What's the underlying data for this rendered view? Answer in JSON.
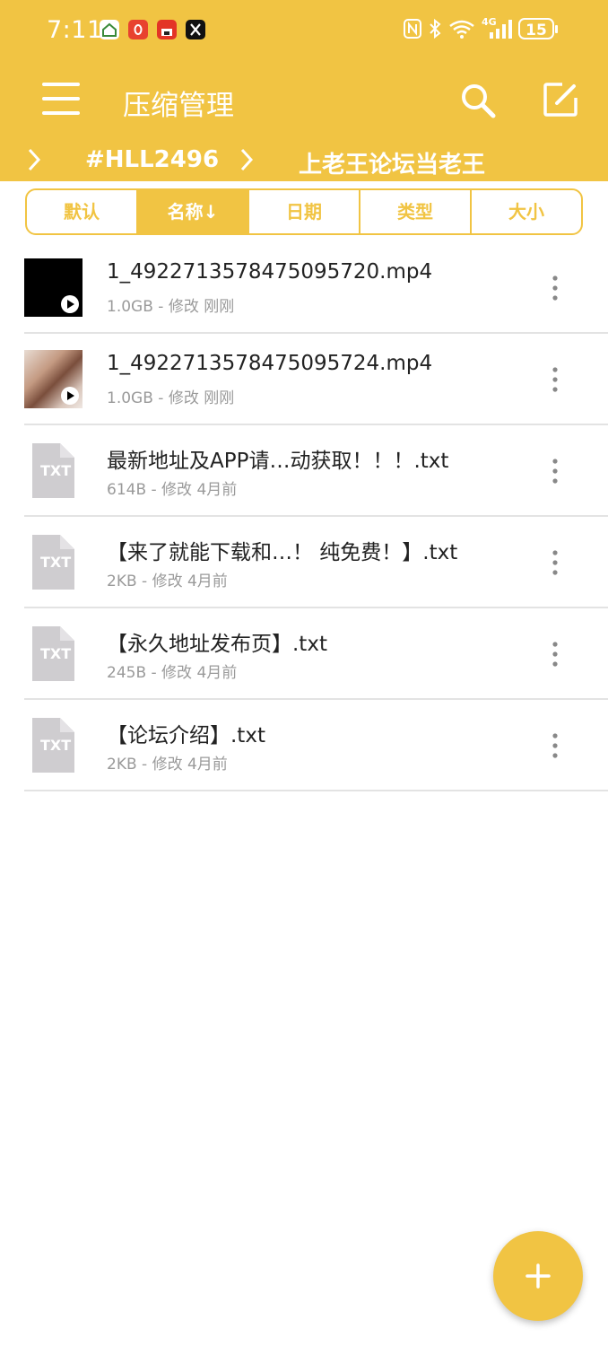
{
  "status_bar": {
    "time": "7:11",
    "battery": "15",
    "network": "4G"
  },
  "app_bar": {
    "title": "压缩管理"
  },
  "breadcrumb": {
    "items": [
      "#HLL2496",
      "上老王论坛当老王"
    ]
  },
  "sort_tabs": [
    {
      "label": "默认",
      "active": false
    },
    {
      "label": "名称↓",
      "active": true
    },
    {
      "label": "日期",
      "active": false
    },
    {
      "label": "类型",
      "active": false
    },
    {
      "label": "大小",
      "active": false
    }
  ],
  "files": [
    {
      "name": "1_4922713578475095720.mp4",
      "meta": "1.0GB - 修改 刚刚",
      "type": "video"
    },
    {
      "name": "1_4922713578475095724.mp4",
      "meta": "1.0GB - 修改 刚刚",
      "type": "video"
    },
    {
      "name": "最新地址及APP请…动获取！！！.txt",
      "meta": "614B - 修改 4月前",
      "type": "txt",
      "icon_label": "TXT"
    },
    {
      "name": "【来了就能下载和…！ 纯免费！】.txt",
      "meta": "2KB - 修改 4月前",
      "type": "txt",
      "icon_label": "TXT"
    },
    {
      "name": "【永久地址发布页】.txt",
      "meta": "245B - 修改 4月前",
      "type": "txt",
      "icon_label": "TXT"
    },
    {
      "name": "【论坛介绍】.txt",
      "meta": "2KB - 修改 4月前",
      "type": "txt",
      "icon_label": "TXT"
    }
  ],
  "colors": {
    "accent": "#f1c443",
    "divider": "#e3e3e3",
    "txt_icon": "#cfcdd0"
  },
  "icons": {
    "menu": "hamburger-icon",
    "search": "search-icon",
    "edit": "edit-icon",
    "fab": "add-icon"
  }
}
